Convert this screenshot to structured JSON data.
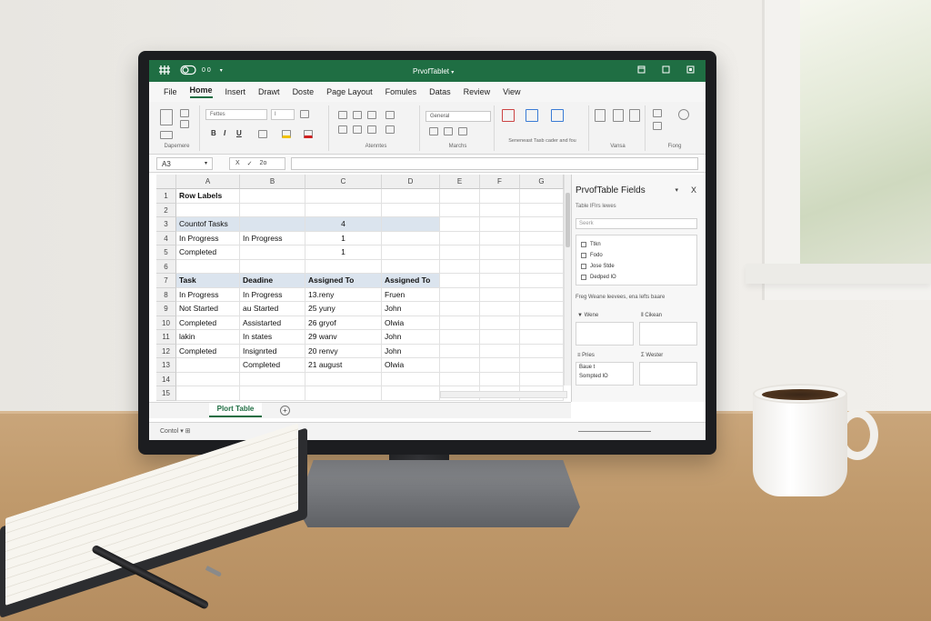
{
  "app": {
    "title": "PrvofTablet",
    "quick_access": "0 0"
  },
  "menu": {
    "items": [
      "File",
      "Home",
      "Insert",
      "Drawt",
      "Doste",
      "Page Layout",
      "Fomules",
      "Datas",
      "Review",
      "View"
    ]
  },
  "ribbon": {
    "font_name": "Fettes",
    "font_size": "I",
    "bold_label": "B",
    "italic_label": "I",
    "underline_label": "U",
    "number_format": "General",
    "clipboard_label": "Dapemere",
    "alignment_label": "Atenntes",
    "number_label": "Marchs",
    "styles_label": "Seneneast Tasb cader and fou",
    "cells_label": "Vansa",
    "editing_label": "Fiong"
  },
  "formula_bar": {
    "name_box": "A3",
    "cancel": "X",
    "enter": "✓",
    "fx": "2o",
    "value": ""
  },
  "grid": {
    "columns": [
      "A",
      "B",
      "C",
      "D",
      "E",
      "F",
      "G"
    ],
    "row_numbers": [
      "1",
      "2",
      "3",
      "4",
      "5",
      "6",
      "7",
      "8",
      "9",
      "10",
      "11",
      "12",
      "13",
      "14",
      "15"
    ],
    "cells": {
      "r1a": "Row Labels",
      "r3a": "Countof Tasks",
      "r3c": "4",
      "r4a": "In Progress",
      "r4b": "In Progress",
      "r4c": "1",
      "r5a": "Completed",
      "r5c": "1",
      "r7a": "Task",
      "r7b": "Deadine",
      "r7c": "Assigned To",
      "r7d": "Assigned To",
      "r8a": "In Progress",
      "r8b": "In Progress",
      "r8c": "13.reny",
      "r8d": "Fruen",
      "r9a": "Not Started",
      "r9b": "au Started",
      "r9c": "25 yuny",
      "r9d": "John",
      "r10a": "Completed",
      "r10b": "Assistarted",
      "r10c": "26 gryof",
      "r10d": "Olwia",
      "r11a": "lakin",
      "r11b": "In states",
      "r11c": "29 wanv",
      "r11d": "John",
      "r12a": "Completed",
      "r12b": "Insignrted",
      "r12c": "20 renvy",
      "r12d": "John",
      "r13b": "Completed",
      "r13c": "21 august",
      "r13d": "Olwia"
    }
  },
  "sheets": {
    "active_tab": "Plort Table",
    "add_label": "+"
  },
  "status": {
    "text": "Contol"
  },
  "pivot_pane": {
    "title": "PrvofTable Fields",
    "subtitle": "Table lFIrs lewes",
    "search_placeholder": "Seerk",
    "fields": [
      "Ttkn",
      "Fodo",
      "Jose Stde",
      "Dedped lO"
    ],
    "drag_hint": "Freg Weane leevees, ena lefts baare",
    "filters_label": "Wene",
    "columns_label": "Cikean",
    "rows_label": "Pries",
    "values_label": "Wester",
    "rows_items": [
      "Baue t",
      "Sompted lO"
    ]
  }
}
